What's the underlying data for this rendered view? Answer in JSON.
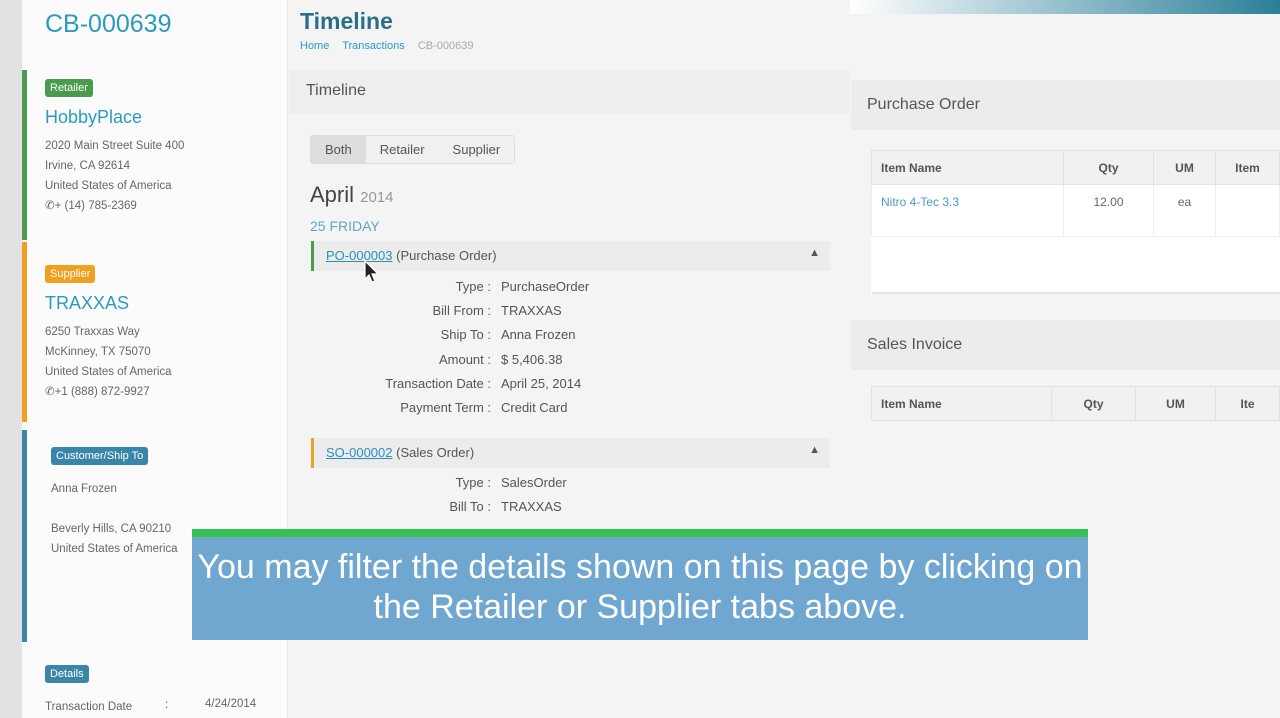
{
  "sidebar": {
    "id": "CB-000639",
    "retailer": {
      "badge": "Retailer",
      "name": "HobbyPlace",
      "lines": [
        "2020 Main Street Suite 400",
        "Irvine, CA 92614",
        "United States of America"
      ],
      "phone": "+ (14) 785-2369"
    },
    "supplier": {
      "badge": "Supplier",
      "name": "TRAXXAS",
      "lines": [
        "6250 Traxxas Way",
        "McKinney, TX 75070",
        "United States of America"
      ],
      "phone": "+1 (888) 872-9927"
    },
    "customer": {
      "badge": "Customer/Ship To",
      "name": "Anna Frozen",
      "lines": [
        "Beverly Hills, CA 90210",
        "United States of America"
      ]
    },
    "details": {
      "badge": "Details",
      "label": "Transaction Date",
      "sep": ":",
      "value": "4/24/2014"
    }
  },
  "header": {
    "title": "Timeline",
    "breadcrumb": [
      "Home",
      "Transactions",
      "CB-000639"
    ]
  },
  "timeline": {
    "title": "Timeline",
    "tabs": [
      "Both",
      "Retailer",
      "Supplier"
    ],
    "month": "April",
    "year": "2014",
    "day": "25 FRIDAY",
    "entries": [
      {
        "id": "PO-000003",
        "type_label": "(Purchase Order)",
        "fields": [
          [
            "Type :",
            "PurchaseOrder"
          ],
          [
            "Bill From :",
            "TRAXXAS"
          ],
          [
            "Ship To :",
            "Anna Frozen"
          ],
          [
            "Amount :",
            "$ 5,406.38"
          ],
          [
            "Transaction Date :",
            "April 25, 2014"
          ],
          [
            "Payment Term :",
            "Credit Card"
          ]
        ]
      },
      {
        "id": "SO-000002",
        "type_label": "(Sales Order)",
        "fields": [
          [
            "Type :",
            "SalesOrder"
          ],
          [
            "Bill To :",
            "TRAXXAS"
          ]
        ]
      }
    ]
  },
  "purchase_order": {
    "title": "Purchase Order",
    "columns": [
      "Item Name",
      "Qty",
      "UM",
      "Item"
    ],
    "rows": [
      [
        "Nitro 4-Tec 3.3",
        "12.00",
        "ea",
        ""
      ]
    ]
  },
  "sales_invoice": {
    "title": "Sales Invoice",
    "columns": [
      "Item Name",
      "Qty",
      "UM",
      "Ite"
    ]
  },
  "caption": "You may filter the details shown on this page by clicking on the Retailer or Supplier tabs above.",
  "colors": {
    "retailer": "#4a9a4f",
    "supplier": "#f0a020",
    "customer": "#3a86a8",
    "accent": "#2a9bbf"
  }
}
